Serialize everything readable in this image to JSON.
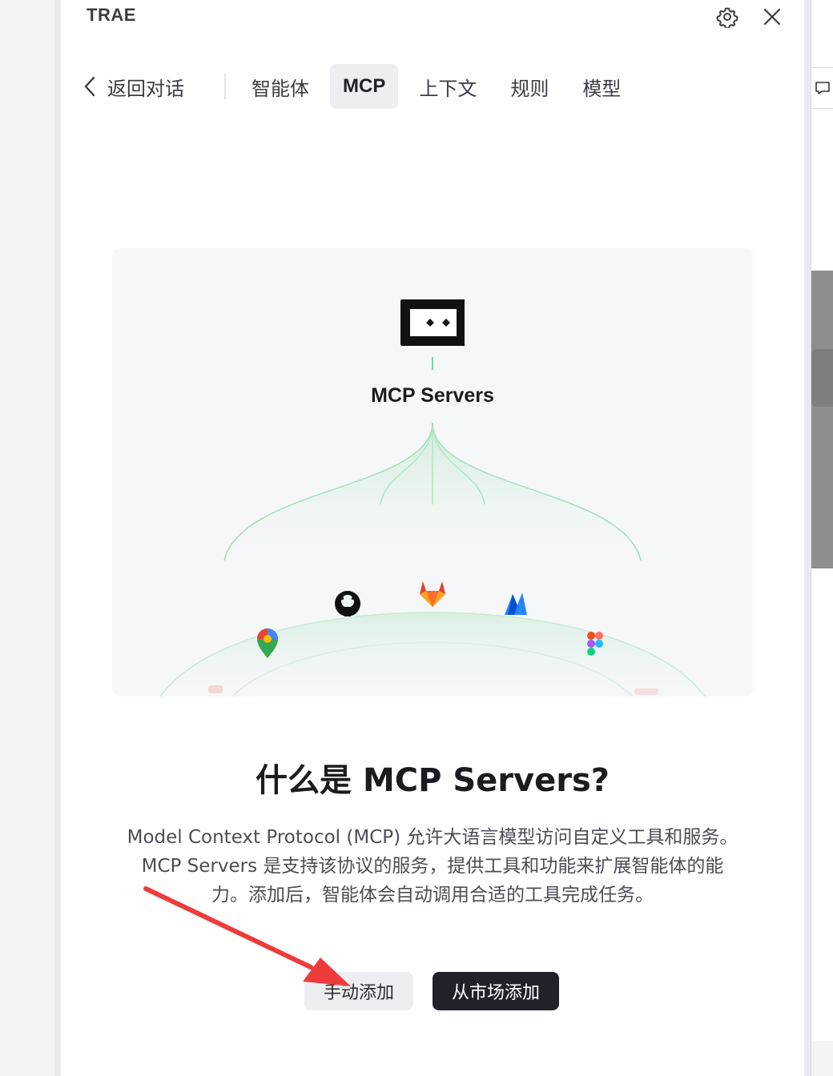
{
  "app": {
    "brand": "TRAE"
  },
  "header": {
    "settings_icon": "gear-icon",
    "close_icon": "close-icon"
  },
  "nav": {
    "back_label": "返回对话",
    "tabs": [
      {
        "label": "智能体",
        "active": false
      },
      {
        "label": "MCP",
        "active": true
      },
      {
        "label": "上下文",
        "active": false
      },
      {
        "label": "规则",
        "active": false
      },
      {
        "label": "模型",
        "active": false
      }
    ]
  },
  "hero": {
    "title": "MCP Servers",
    "icons": [
      "mcp-logo-icon",
      "github-icon",
      "gitlab-icon",
      "atlassian-icon",
      "google-maps-icon",
      "figma-icon"
    ]
  },
  "main": {
    "heading": "什么是 MCP Servers?",
    "description": [
      "Model Context Protocol (MCP) 允许大语言模型访问自定义工具和服务。",
      "MCP Servers 是支持该协议的服务，提供工具和功能来扩展智能体的能",
      "力。添加后，智能体会自动调用合适的工具完成任务。"
    ],
    "manual_add_label": "手动添加",
    "market_add_label": "从市场添加"
  },
  "colors": {
    "accent_green": "#7fd3a1",
    "annotation_arrow": "#ee3b3b",
    "primary_button": "#1f2329"
  }
}
